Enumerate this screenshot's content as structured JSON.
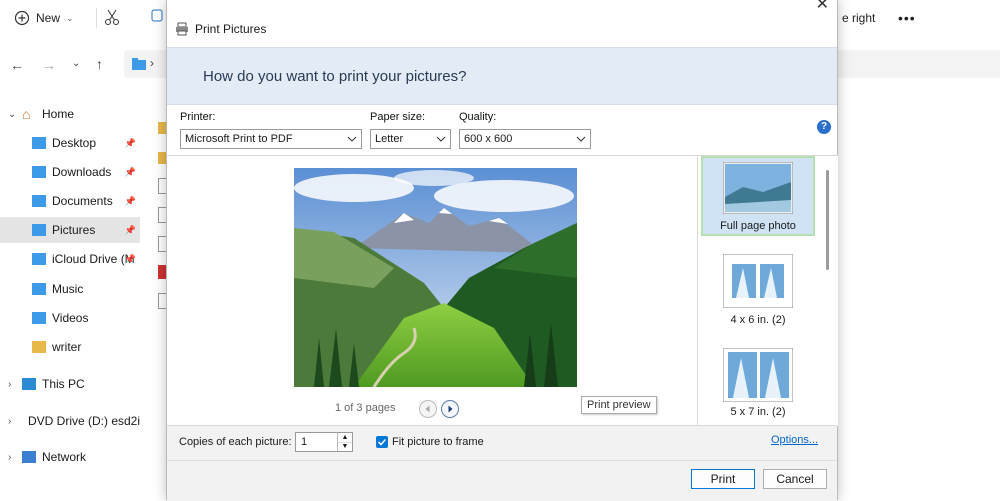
{
  "explorer": {
    "new_label": "New",
    "right_label": "e right",
    "more_label": "•••",
    "address_sep": "›",
    "sidebar": [
      {
        "label": "Home",
        "icon": "home-icon",
        "pinned": false
      },
      {
        "label": "Desktop",
        "icon": "folder-icon",
        "pinned": true
      },
      {
        "label": "Downloads",
        "icon": "folder-icon",
        "pinned": true
      },
      {
        "label": "Documents",
        "icon": "folder-icon",
        "pinned": true
      },
      {
        "label": "Pictures",
        "icon": "folder-icon",
        "pinned": true
      },
      {
        "label": "iCloud Drive (M",
        "icon": "folder-icon",
        "pinned": true
      },
      {
        "label": "Music",
        "icon": "folder-icon",
        "pinned": false
      },
      {
        "label": "Videos",
        "icon": "folder-icon",
        "pinned": false
      },
      {
        "label": "writer",
        "icon": "folder-icon",
        "pinned": false
      },
      {
        "label": "This PC",
        "icon": "pc-icon",
        "pinned": false
      },
      {
        "label": "DVD Drive (D:) esd2i",
        "icon": "dvd-icon",
        "pinned": false
      },
      {
        "label": "Network",
        "icon": "network-icon",
        "pinned": false
      }
    ]
  },
  "dialog": {
    "title": "Print Pictures",
    "header": "How do you want to print your pictures?",
    "printer_label": "Printer:",
    "printer_value": "Microsoft Print to PDF",
    "paper_label": "Paper size:",
    "paper_value": "Letter",
    "quality_label": "Quality:",
    "quality_value": "600 x 600",
    "pages_text": "1 of 3 pages",
    "tooltip": "Print preview",
    "layouts": [
      {
        "label": "Full page photo",
        "selected": true
      },
      {
        "label": "4 x 6 in. (2)",
        "selected": false
      },
      {
        "label": "5 x 7 in. (2)",
        "selected": false
      }
    ],
    "copies_label": "Copies of each picture:",
    "copies_value": "1",
    "fit_label": "Fit picture to frame",
    "fit_checked": true,
    "options_link": "Options...",
    "print_button": "Print",
    "cancel_button": "Cancel",
    "help": "?"
  },
  "colors": {
    "accent": "#0078d7",
    "header_bg": "#e3ecf6",
    "selection_border": "#b6e0b0"
  }
}
